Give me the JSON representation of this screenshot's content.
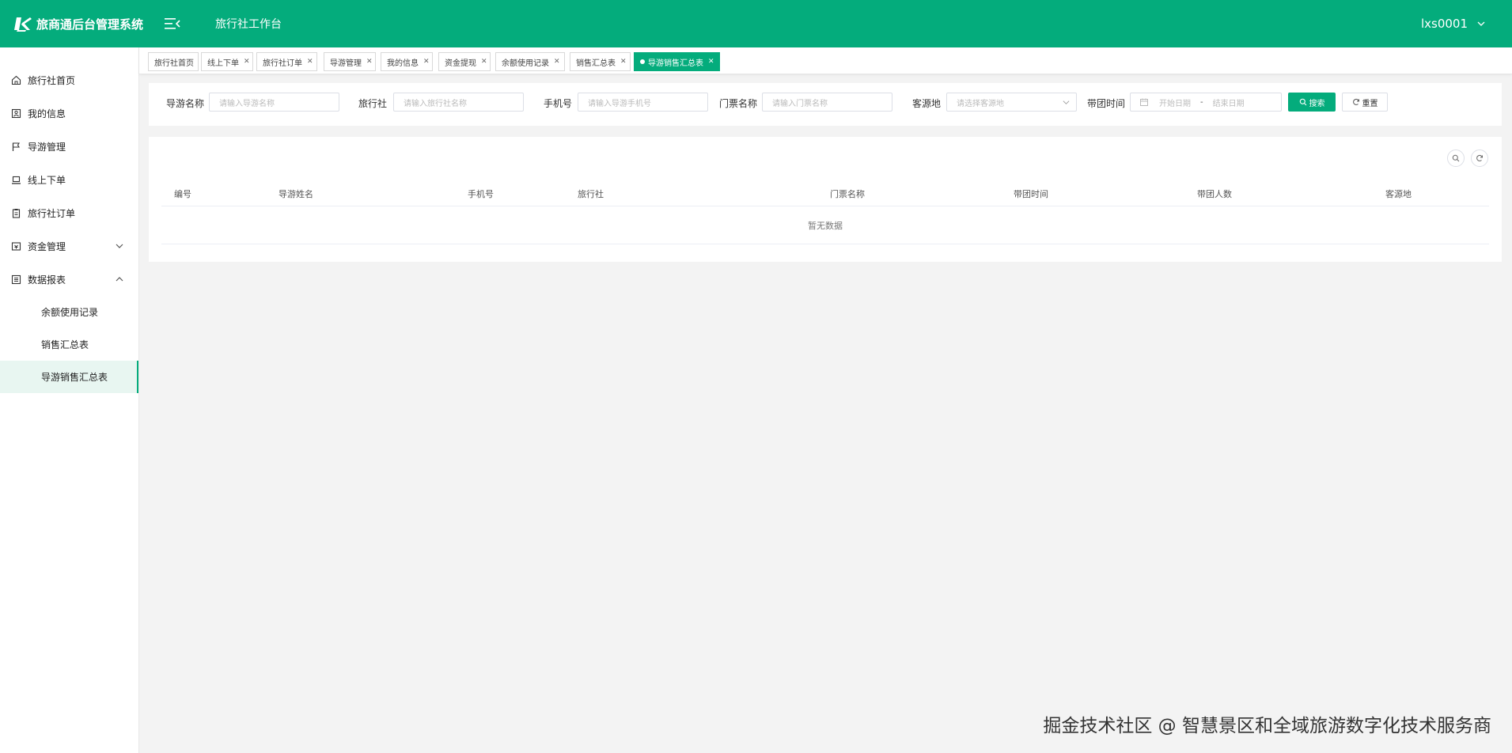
{
  "header": {
    "app_title": "旅商通后台管理系统",
    "workbench": "旅行社工作台",
    "username": "lxs0001",
    "accent_color": "#04ac7c"
  },
  "sidebar": {
    "items": [
      {
        "label": "旅行社首页",
        "icon": "home-icon"
      },
      {
        "label": "我的信息",
        "icon": "profile-icon"
      },
      {
        "label": "导游管理",
        "icon": "flag-icon"
      },
      {
        "label": "线上下单",
        "icon": "laptop-icon"
      },
      {
        "label": "旅行社订单",
        "icon": "clipboard-icon"
      },
      {
        "label": "资金管理",
        "icon": "wallet-icon",
        "expanded": false
      },
      {
        "label": "数据报表",
        "icon": "report-icon",
        "expanded": true
      }
    ],
    "subitems": [
      {
        "label": "余额使用记录"
      },
      {
        "label": "销售汇总表"
      },
      {
        "label": "导游销售汇总表",
        "active": true
      }
    ]
  },
  "tabs": [
    {
      "label": "旅行社首页"
    },
    {
      "label": "线上下单"
    },
    {
      "label": "旅行社订单"
    },
    {
      "label": "导游管理"
    },
    {
      "label": "我的信息"
    },
    {
      "label": "资金提现"
    },
    {
      "label": "余额使用记录"
    },
    {
      "label": "销售汇总表"
    },
    {
      "label": "导游销售汇总表",
      "active": true
    }
  ],
  "filters": {
    "guide_name": {
      "label": "导游名称",
      "placeholder": "请输入导游名称"
    },
    "agency": {
      "label": "旅行社",
      "placeholder": "请输入旅行社名称"
    },
    "phone": {
      "label": "手机号",
      "placeholder": "请输入导游手机号"
    },
    "ticket": {
      "label": "门票名称",
      "placeholder": "请输入门票名称"
    },
    "source": {
      "label": "客源地",
      "placeholder": "请选择客源地"
    },
    "tour_time": {
      "label": "带团时间",
      "start_placeholder": "开始日期",
      "separator": "-",
      "end_placeholder": "结束日期"
    },
    "search_label": "搜索",
    "reset_label": "重置"
  },
  "table": {
    "columns": [
      "编号",
      "导游姓名",
      "手机号",
      "旅行社",
      "门票名称",
      "带团时间",
      "带团人数",
      "客源地"
    ],
    "rows": [],
    "empty_text": "暂无数据"
  },
  "watermark": "掘金技术社区 @ 智慧景区和全域旅游数字化技术服务商"
}
